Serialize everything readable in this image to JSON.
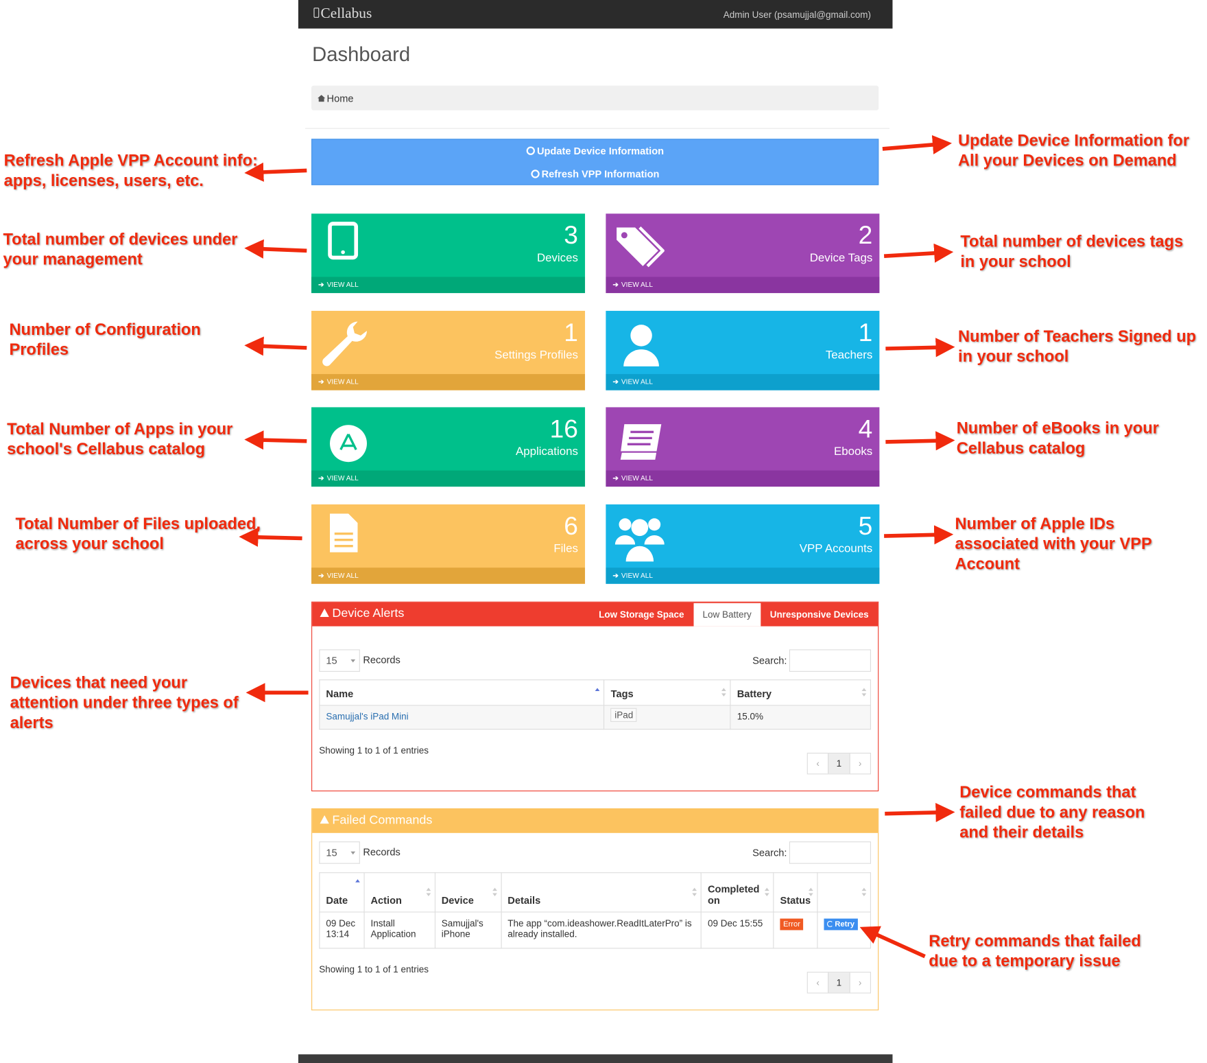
{
  "app": {
    "brand": "Cellabus",
    "user": "Admin User (psamujjal@gmail.com)"
  },
  "page": {
    "title": "Dashboard",
    "breadcrumb": "Home"
  },
  "actions": {
    "update_device": "Update Device Information",
    "refresh_vpp": "Refresh VPP Information"
  },
  "tiles": [
    {
      "count": "3",
      "label": "Devices",
      "link": "VIEW ALL",
      "color": "#00c08b",
      "icon": "tablet-icon"
    },
    {
      "count": "2",
      "label": "Device Tags",
      "link": "VIEW ALL",
      "color": "#9e46b3",
      "icon": "tags-icon"
    },
    {
      "count": "1",
      "label": "Settings Profiles",
      "link": "VIEW ALL",
      "color": "#fcc35f",
      "icon": "wrench-icon"
    },
    {
      "count": "1",
      "label": "Teachers",
      "link": "VIEW ALL",
      "color": "#17b5e6",
      "icon": "user-icon"
    },
    {
      "count": "16",
      "label": "Applications",
      "link": "VIEW ALL",
      "color": "#00c08b",
      "icon": "app-store-icon"
    },
    {
      "count": "4",
      "label": "Ebooks",
      "link": "VIEW ALL",
      "color": "#9e46b3",
      "icon": "book-icon"
    },
    {
      "count": "6",
      "label": "Files",
      "link": "VIEW ALL",
      "color": "#fcc35f",
      "icon": "file-icon"
    },
    {
      "count": "5",
      "label": "VPP Accounts",
      "link": "VIEW ALL",
      "color": "#17b5e6",
      "icon": "users-icon"
    }
  ],
  "alerts": {
    "title": "Device Alerts",
    "tabs": [
      "Low Storage Space",
      "Low Battery",
      "Unresponsive Devices"
    ],
    "active_tab": "Low Battery",
    "length": "15",
    "records_label": "Records",
    "search_label": "Search:",
    "columns": [
      "Name",
      "Tags",
      "Battery"
    ],
    "rows": [
      {
        "name": "Samujjal's iPad Mini",
        "tag": "iPad",
        "battery": "15.0%"
      }
    ],
    "showing": "Showing 1 to 1 of 1 entries",
    "page": "1"
  },
  "failed": {
    "title": "Failed Commands",
    "length": "15",
    "records_label": "Records",
    "search_label": "Search:",
    "columns": [
      "Date",
      "Action",
      "Device",
      "Details",
      "Completed on",
      "Status"
    ],
    "rows": [
      {
        "date": "09 Dec 13:14",
        "action": "Install Application",
        "device": "Samujjal's iPhone",
        "details": "The app “com.ideashower.ReadItLaterPro” is already installed.",
        "completed": "09 Dec 15:55",
        "status": "Error",
        "retry": "Retry"
      }
    ],
    "showing": "Showing 1 to 1 of 1 entries",
    "page": "1"
  },
  "annotations": {
    "refresh_vpp": "Refresh Apple VPP Account info: apps, licenses, users, etc.",
    "update_device": "Update Device Information for All your Devices on Demand",
    "devices": "Total number of devices under your management",
    "tags": "Total number of devices tags in your school",
    "profiles": "Number of Configuration Profiles",
    "teachers": "Number of Teachers Signed up in your school",
    "apps": "Total Number of Apps in your school's Cellabus catalog",
    "ebooks": "Number of eBooks in your Cellabus catalog",
    "files": "Total Number of Files uploaded, across your school",
    "vpp": "Number of Apple IDs associated with your VPP Account",
    "alerts": "Devices that need your attention under three types of alerts",
    "failed": "Device commands that failed due to any reason and their details",
    "retry": "Retry commands that failed due to a temporary issue"
  },
  "colors": {
    "annotation": "#f02a0d",
    "alert_red": "#ee3d2f",
    "warning_yellow": "#fcc35f",
    "action_blue": "#5ba4f7"
  }
}
